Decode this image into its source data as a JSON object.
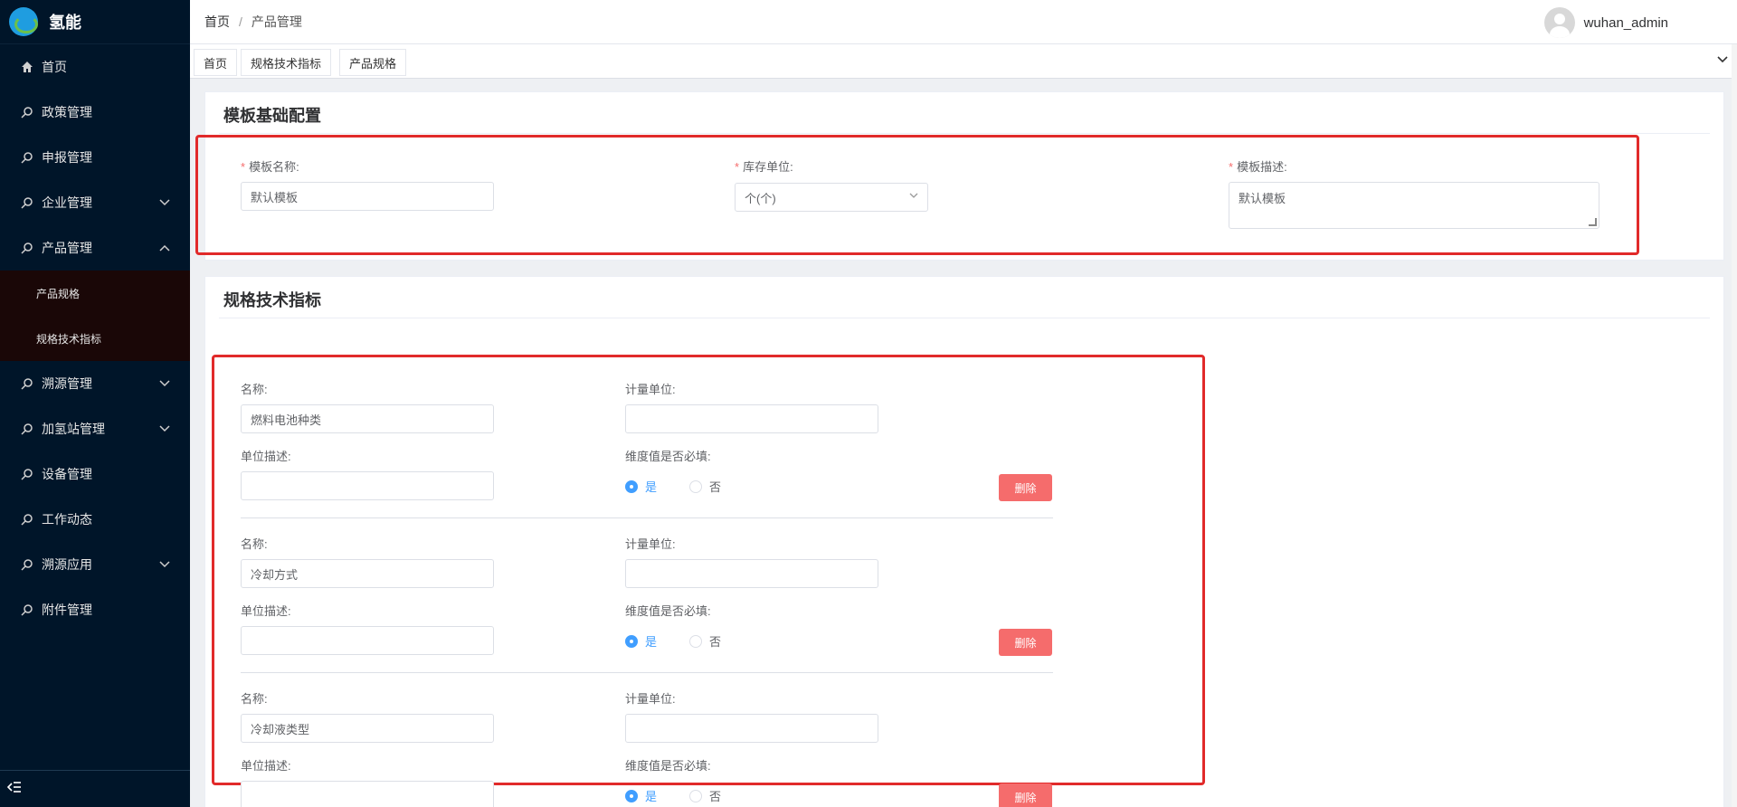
{
  "app": {
    "name": "氢能"
  },
  "sidebar": {
    "items": [
      {
        "label": "首页",
        "icon": "home-icon",
        "has_children": false
      },
      {
        "label": "政策管理",
        "icon": "search-icon",
        "has_children": false
      },
      {
        "label": "申报管理",
        "icon": "search-icon",
        "has_children": false
      },
      {
        "label": "企业管理",
        "icon": "search-icon",
        "has_children": true,
        "expanded": false
      },
      {
        "label": "产品管理",
        "icon": "search-icon",
        "has_children": true,
        "expanded": true
      }
    ],
    "product_submenu": [
      "产品规格",
      "规格技术指标"
    ],
    "items_after": [
      {
        "label": "溯源管理",
        "icon": "search-icon",
        "has_children": true
      },
      {
        "label": "加氢站管理",
        "icon": "search-icon",
        "has_children": true
      },
      {
        "label": "设备管理",
        "icon": "search-icon",
        "has_children": false
      },
      {
        "label": "工作动态",
        "icon": "search-icon",
        "has_children": false
      },
      {
        "label": "溯源应用",
        "icon": "search-icon",
        "has_children": true
      },
      {
        "label": "附件管理",
        "icon": "search-icon",
        "has_children": false
      }
    ],
    "collapse_icon": "collapse-icon"
  },
  "header": {
    "breadcrumb": [
      "首页",
      "产品管理"
    ],
    "separator": "/",
    "username": "wuhan_admin"
  },
  "tags": [
    "首页",
    "规格技术指标",
    "产品规格"
  ],
  "template_config": {
    "title": "模板基础配置",
    "name_label": "模板名称:",
    "name_value": "默认模板",
    "unit_label": "库存单位:",
    "unit_value": "个(个)",
    "desc_label": "模板描述:",
    "desc_value": "默认模板"
  },
  "spec_section": {
    "title": "规格技术指标",
    "labels": {
      "name": "名称:",
      "unit": "计量单位:",
      "unit_desc": "单位描述:",
      "required": "维度值是否必填:",
      "yes": "是",
      "no": "否",
      "delete": "删除"
    },
    "rows": [
      {
        "name": "燃料电池种类",
        "unit": "",
        "unit_desc": "",
        "required": "是"
      },
      {
        "name": "冷却方式",
        "unit": "",
        "unit_desc": "",
        "required": "是"
      },
      {
        "name": "冷却液类型",
        "unit": "",
        "unit_desc": "",
        "required": "是"
      }
    ]
  },
  "colors": {
    "sidebar_bg": "#001529",
    "primary": "#409eff",
    "danger": "#f56c6c",
    "highlight_box": "#e12a2a"
  }
}
